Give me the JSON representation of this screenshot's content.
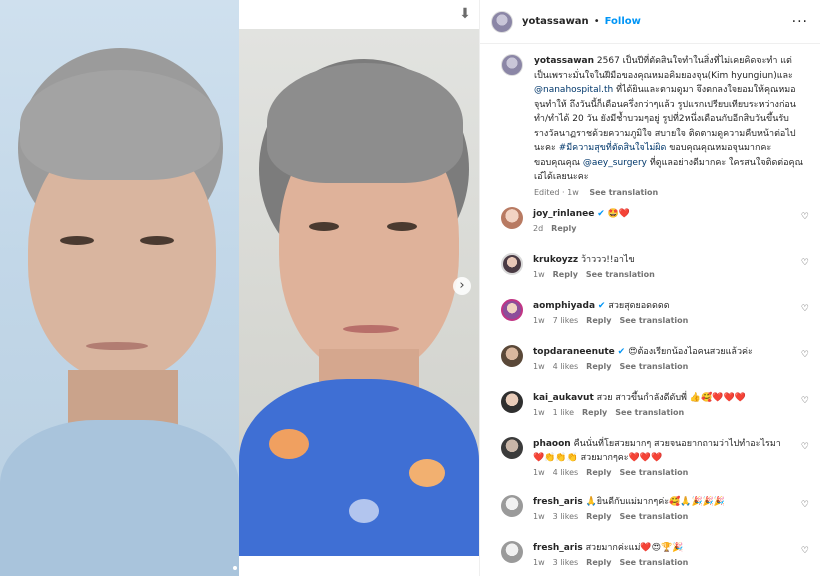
{
  "header": {
    "username": "yotassawan",
    "separator": "•",
    "follow_label": "Follow",
    "more_label": "···"
  },
  "media": {
    "download_icon": "download-icon",
    "next_label": "›",
    "slide_count": 5,
    "active_slide": 1
  },
  "caption": {
    "username": "yotassawan",
    "text_1": "2567 เป็นปีที่ตัดสินใจทำในสิ่งที่ไม่เคยคิดจะทำ แต่เป็นเพราะมั่นใจในฝีมือของคุณหมอคิมยองจุน(Kim hyungiun)และ ",
    "link_1": "@nanahospital.th",
    "text_2": " ที่ได้ยินและตามดูมา จึงตกลงใจยอมให้คุณหมอจุนทำให้ ถึงวันนี้ก็เดือนครึ่งกว่าๆแล้ว รูปแรกเปรียบเทียบระหว่างก่อนทำ/ทำได้ 20 วัน ยังมีช้ำบวมๆอยู่ รูปที่2หนึ่งเดือนกับอีกสิบวันขึ้นรับรางวัลนาฏราชด้วยความภูมิใจ สบายใจ ติดตามดูความคืบหน้าต่อไปนะคะ ",
    "hashtag": "#มีความสุขที่ตัดสินใจไม่ผิด",
    "text_3": " ขอบคุณคุณหมอจุนมากคะ ขอบคุณคุณ ",
    "link_2": "@aey_surgery",
    "text_4": " ที่ดูแลอย่างดีมากคะ ใครสนใจติดต่อคุณเอ๋ได้เลยนะคะ",
    "edited": "Edited · 1w",
    "see_translation": "See translation"
  },
  "comments": [
    {
      "username": "joy_rinlanee",
      "verified": true,
      "text": "🤩❤️",
      "time": "2d",
      "likes": "",
      "reply": "Reply",
      "translation": ""
    },
    {
      "username": "krukoyzz",
      "verified": false,
      "text": "ว้าววว!!อาไข",
      "time": "1w",
      "likes": "",
      "reply": "Reply",
      "translation": "See translation"
    },
    {
      "username": "aomphiyada",
      "verified": true,
      "text": "สวยสุดยอดดดด",
      "time": "1w",
      "likes": "7 likes",
      "reply": "Reply",
      "translation": "See translation"
    },
    {
      "username": "topdaraneenute",
      "verified": true,
      "text": "😍ต้องเรียกน้องไอคนสวยแล้วค่ะ",
      "time": "1w",
      "likes": "4 likes",
      "reply": "Reply",
      "translation": "See translation"
    },
    {
      "username": "kai_aukavut",
      "verified": false,
      "text": "สวย สาวขึ้นกำลังดีดับพี่ 👍🥰❤️❤️❤️",
      "time": "1w",
      "likes": "1 like",
      "reply": "Reply",
      "translation": "See translation"
    },
    {
      "username": "phaoon",
      "verified": false,
      "text": "คืนนั่นที่โยสวยมากๆ สวยจนอยากถามว่าไปทำอะไรมา ❤️👏👏👏 สวยมากๆคะ❤️❤️❤️",
      "time": "1w",
      "likes": "4 likes",
      "reply": "Reply",
      "translation": "See translation"
    },
    {
      "username": "fresh_aris",
      "verified": false,
      "text": "🙏ยินดีกับแม่มากๆค่ะ🥰🙏🎉🎉🎉",
      "time": "1w",
      "likes": "3 likes",
      "reply": "Reply",
      "translation": "See translation"
    },
    {
      "username": "fresh_aris",
      "verified": false,
      "text": "สวยมากค่ะแม่❤️😍🏆🎉",
      "time": "1w",
      "likes": "3 likes",
      "reply": "Reply",
      "translation": "See translation"
    }
  ],
  "colors": {
    "link": "#00376b",
    "follow": "#0095f6",
    "verified": "#0095f6"
  }
}
